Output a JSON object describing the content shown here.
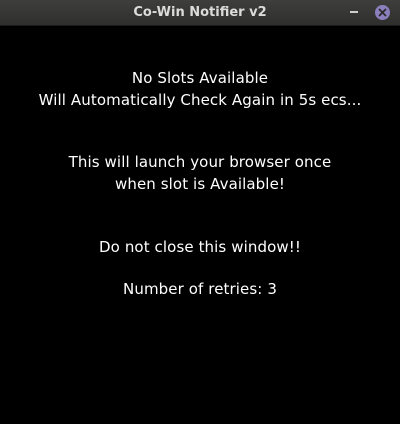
{
  "window": {
    "title": "Co-Win Notifier v2"
  },
  "message": {
    "status_line1": "No Slots Available",
    "status_line2": "Will Automatically Check Again in 5s ecs...",
    "info_line1": "This will launch your browser once",
    "info_line2": "when slot is Available!",
    "warning": "Do not close this window!!",
    "retries": "Number of retries: 3"
  },
  "icons": {
    "minimize": "minimize-icon",
    "close": "close-icon"
  },
  "colors": {
    "background": "#000000",
    "text": "#ffffff",
    "close_button": "#8c7fbe"
  }
}
